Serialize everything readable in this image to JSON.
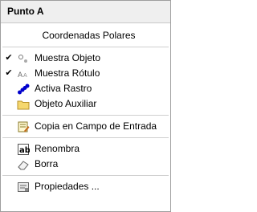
{
  "menu": {
    "title": "Punto A",
    "items": {
      "polar": {
        "label": "Coordenadas Polares"
      },
      "show_object": {
        "label": "Muestra Objeto",
        "checked": true,
        "icon": "show-object-icon"
      },
      "show_label": {
        "label": "Muestra Rótulo",
        "checked": true,
        "icon": "show-label-icon"
      },
      "trace": {
        "label": "Activa Rastro",
        "icon": "trace-icon"
      },
      "auxiliary": {
        "label": "Objeto Auxiliar",
        "icon": "folder-icon"
      },
      "copy_input": {
        "label": "Copia en Campo de Entrada",
        "icon": "copy-to-input-icon"
      },
      "rename": {
        "label": "Renombra",
        "icon": "rename-icon"
      },
      "delete": {
        "label": "Borra",
        "icon": "eraser-icon"
      },
      "properties": {
        "label": "Propiedades ...",
        "icon": "properties-icon"
      }
    },
    "check_glyph": "✔",
    "colors": {
      "header_bg": "#efefef",
      "trace_blue": "#0000cc",
      "folder_yellow": "#f5d76e"
    }
  }
}
